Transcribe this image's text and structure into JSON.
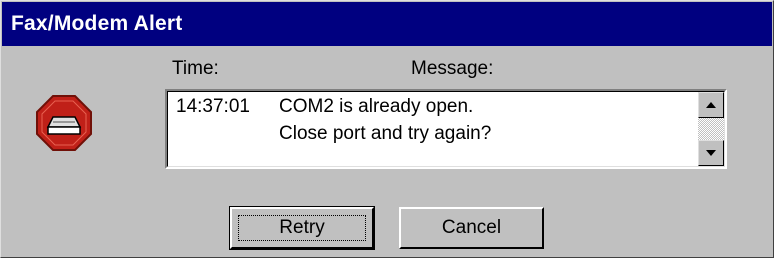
{
  "window": {
    "title": "Fax/Modem Alert"
  },
  "labels": {
    "time": "Time:",
    "message": "Message:"
  },
  "message": {
    "time": "14:37:01",
    "lines": [
      "COM2 is already open.",
      "Close port and try again?"
    ]
  },
  "buttons": {
    "retry": "Retry",
    "cancel": "Cancel"
  },
  "icons": {
    "alert": "stop-modem-icon",
    "scroll_up": "scroll-up-arrow-icon",
    "scroll_down": "scroll-down-arrow-icon"
  },
  "colors": {
    "titlebar": "#000080",
    "stop_red": "#c02018",
    "face": "#c0c0c0"
  }
}
